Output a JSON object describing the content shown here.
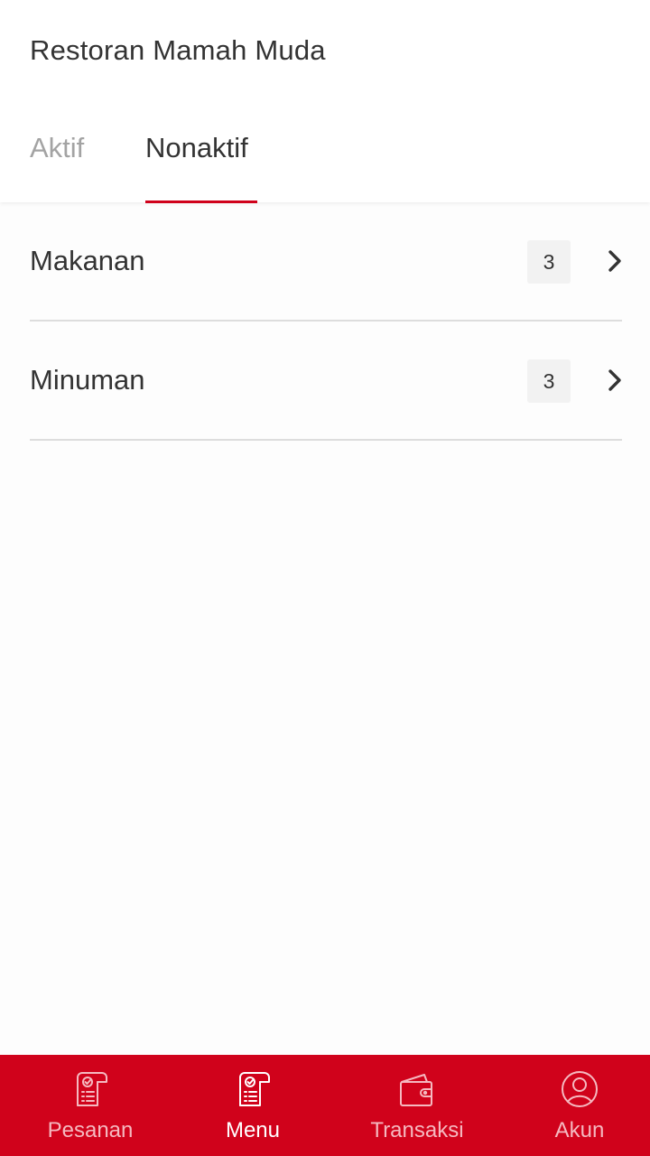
{
  "header": {
    "title": "Restoran Mamah Muda"
  },
  "tabs": [
    {
      "label": "Aktif",
      "selected": false
    },
    {
      "label": "Nonaktif",
      "selected": true
    }
  ],
  "categories": [
    {
      "name": "Makanan",
      "count": "3"
    },
    {
      "name": "Minuman",
      "count": "3"
    }
  ],
  "bottom_nav": [
    {
      "label": "Pesanan",
      "icon": "order-list-icon",
      "active": false
    },
    {
      "label": "Menu",
      "icon": "menu-list-icon",
      "active": true
    },
    {
      "label": "Transaksi",
      "icon": "wallet-icon",
      "active": false
    },
    {
      "label": "Akun",
      "icon": "account-icon",
      "active": false
    }
  ],
  "colors": {
    "accent": "#d0021b",
    "text": "#333333",
    "inactive_tab": "#a3a3a3",
    "badge_bg": "#f2f2f2"
  }
}
